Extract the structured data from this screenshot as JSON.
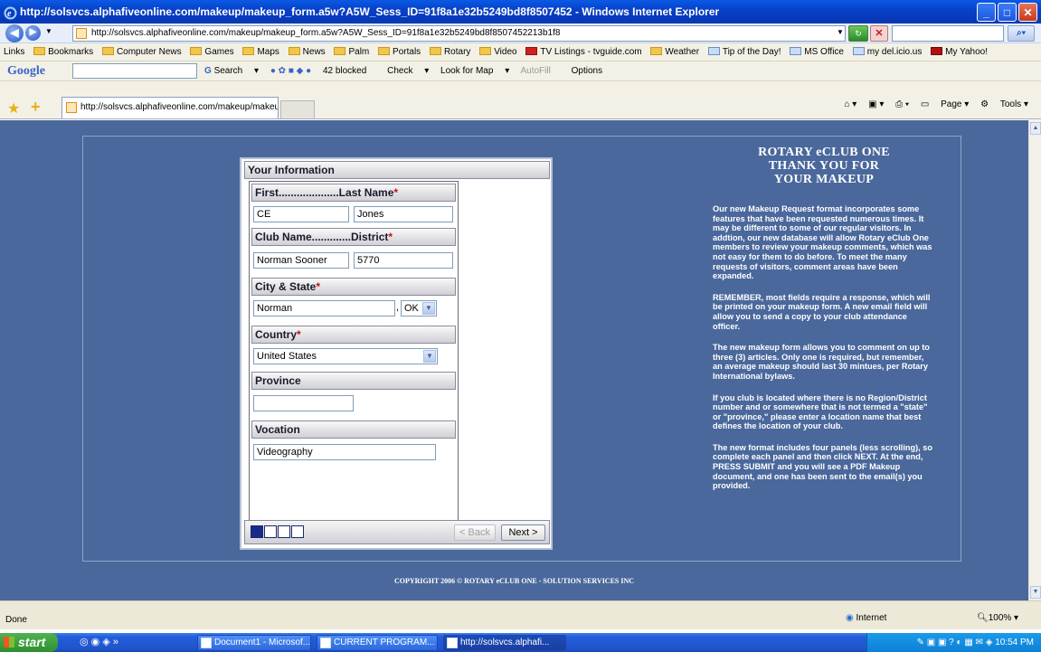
{
  "window": {
    "title": "http://solsvcs.alphafiveonline.com/makeup/makeup_form.a5w?A5W_Sess_ID=91f8a1e32b5249bd8f8507452 - Windows Internet Explorer"
  },
  "address": {
    "url": "http://solsvcs.alphafiveonline.com/makeup/makeup_form.a5w?A5W_Sess_ID=91f8a1e32b5249bd8f8507452213b1f8"
  },
  "links": {
    "label": "Links",
    "items": [
      "Bookmarks",
      "Computer News",
      "Games",
      "Maps",
      "News",
      "Palm",
      "Portals",
      "Rotary",
      "Video",
      "TV Listings - tvguide.com",
      "Weather",
      "Tip of the Day!",
      "MS Office",
      "my del.icio.us",
      "My Yahoo!"
    ]
  },
  "google": {
    "logo": "Google",
    "search": "Search",
    "blocked": "42 blocked",
    "check": "Check",
    "lookfor": "Look for Map",
    "autofill": "AutoFill",
    "options": "Options"
  },
  "tab": {
    "title": "http://solsvcs.alphafiveonline.com/makeup/makeup_f..."
  },
  "tabtools": {
    "page": "Page",
    "tools": "Tools"
  },
  "form": {
    "section_title": "Your Information",
    "name_label": "First....................Last Name",
    "first": "CE",
    "last": "Jones",
    "club_label": "Club Name.............District",
    "club": "Norman Sooner",
    "district": "5770",
    "city_label": "City & State",
    "city": "Norman",
    "state": "OK",
    "country_label": "Country",
    "country": "United States",
    "province_label": "Province",
    "province": "",
    "vocation_label": "Vocation",
    "vocation": "Videography",
    "required_mark": "*",
    "back": "< Back",
    "next": "Next >"
  },
  "info": {
    "title1": "ROTARY eCLUB ONE",
    "title2": "THANK YOU FOR",
    "title3": "YOUR MAKEUP",
    "p1": "Our new Makeup Request format incorporates some features that have been requested numerous times. It may be different to some of our regular visitors. In addtion, our new database will allow Rotary eClub One members to review your makeup comments, which was not easy for them to do before. To meet the many requests of visitors, comment areas have been expanded.",
    "p2": "REMEMBER, most fields require a response, which will be printed on your makeup form. A new email field will allow you to send a copy to your club attendance officer.",
    "p3": "The new makeup form allows you to comment on up to three (3) articles. Only one is required, but remember, an average makeup should last 30 mintues, per Rotary International bylaws.",
    "p4": "If you club is located where there is no Region/District number and or somewhere that is not termed a \"state\" or \"province,\" please enter a location name that best defines the location of your club.",
    "p5": "The new format includes four panels (less scrolling), so complete each panel and then click NEXT. At the end, PRESS SUBMIT and you will see a PDF Makeup document, and one has been sent to the email(s) you provided."
  },
  "copyright": "COPYRIGHT 2006 © ROTARY eCLUB ONE - SOLUTION SERVICES INC",
  "status": {
    "text": "Done",
    "zone": "Internet",
    "zoom": "100%"
  },
  "taskbar": {
    "start": "start",
    "tasks": [
      "Document1 - Microsof...",
      "CURRENT PROGRAM...",
      "http://solsvcs.alphafi..."
    ],
    "clock": "10:54 PM"
  }
}
